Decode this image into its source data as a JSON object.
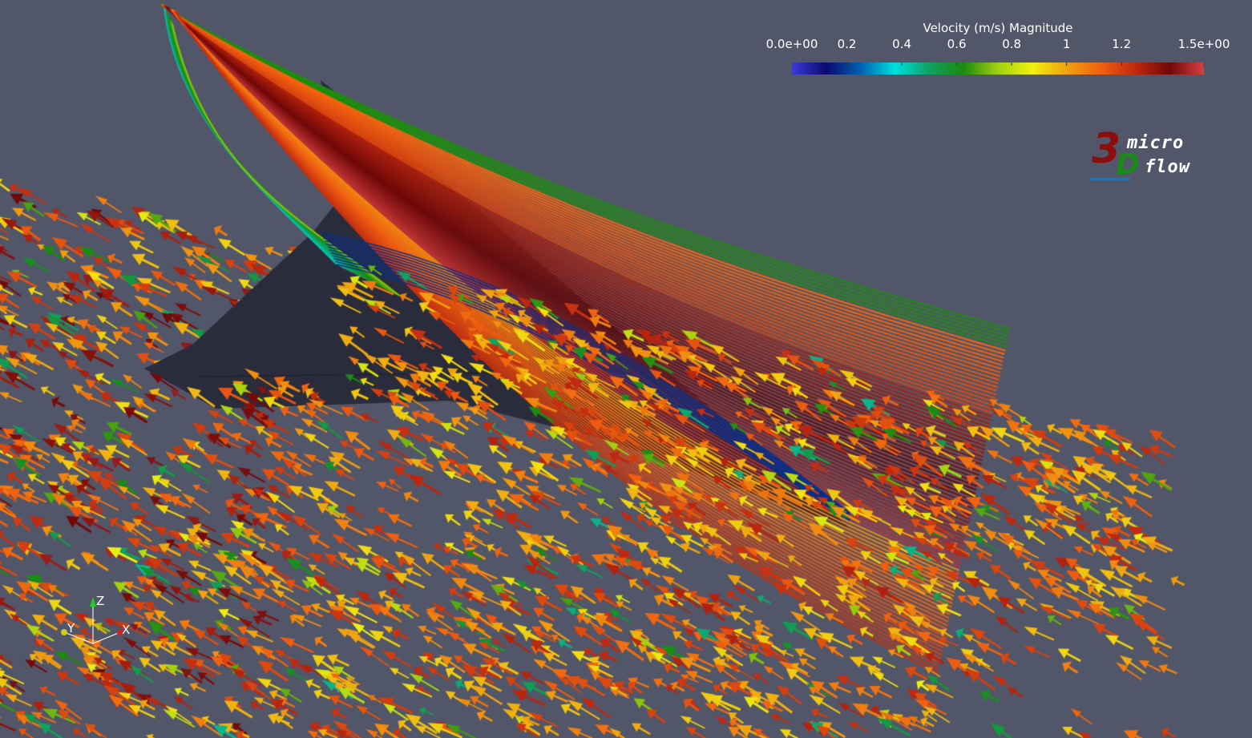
{
  "colorbar": {
    "title": "Velocity (m/s) Magnitude",
    "range": [
      0,
      1.5
    ],
    "ticks": [
      {
        "label": "0.0e+00",
        "value": 0.0
      },
      {
        "label": "0.2",
        "value": 0.2
      },
      {
        "label": "0.4",
        "value": 0.4
      },
      {
        "label": "0.6",
        "value": 0.6
      },
      {
        "label": "0.8",
        "value": 0.8
      },
      {
        "label": "1",
        "value": 1.0
      },
      {
        "label": "1.2",
        "value": 1.2
      },
      {
        "label": "1.5e+00",
        "value": 1.5
      }
    ],
    "colormap": [
      "#3b3bd6",
      "#0a0a70",
      "#0060b0",
      "#00e0e0",
      "#10a060",
      "#1a8a10",
      "#a0d010",
      "#f0f010",
      "#f0a010",
      "#f06010",
      "#c02810",
      "#700808",
      "#d64040"
    ]
  },
  "logo": {
    "digit": "3",
    "letter": "D",
    "word1": "micro",
    "word2": "flow",
    "colors": {
      "digit": "#8b0d0d",
      "letter": "#1a8a1a",
      "text": "#ffffff",
      "underline": "#2d6fa8"
    }
  },
  "axes": {
    "z": "Z",
    "y": "Y",
    "x": "X",
    "colors": {
      "z": "#22cc22",
      "y": "#cccc22",
      "x": "#cc2222"
    }
  },
  "scene": {
    "background": "#525669",
    "body_color": "#2a2c3c",
    "icons": [
      "airfoil-body",
      "streamlines",
      "velocity-arrow-glyphs"
    ]
  }
}
